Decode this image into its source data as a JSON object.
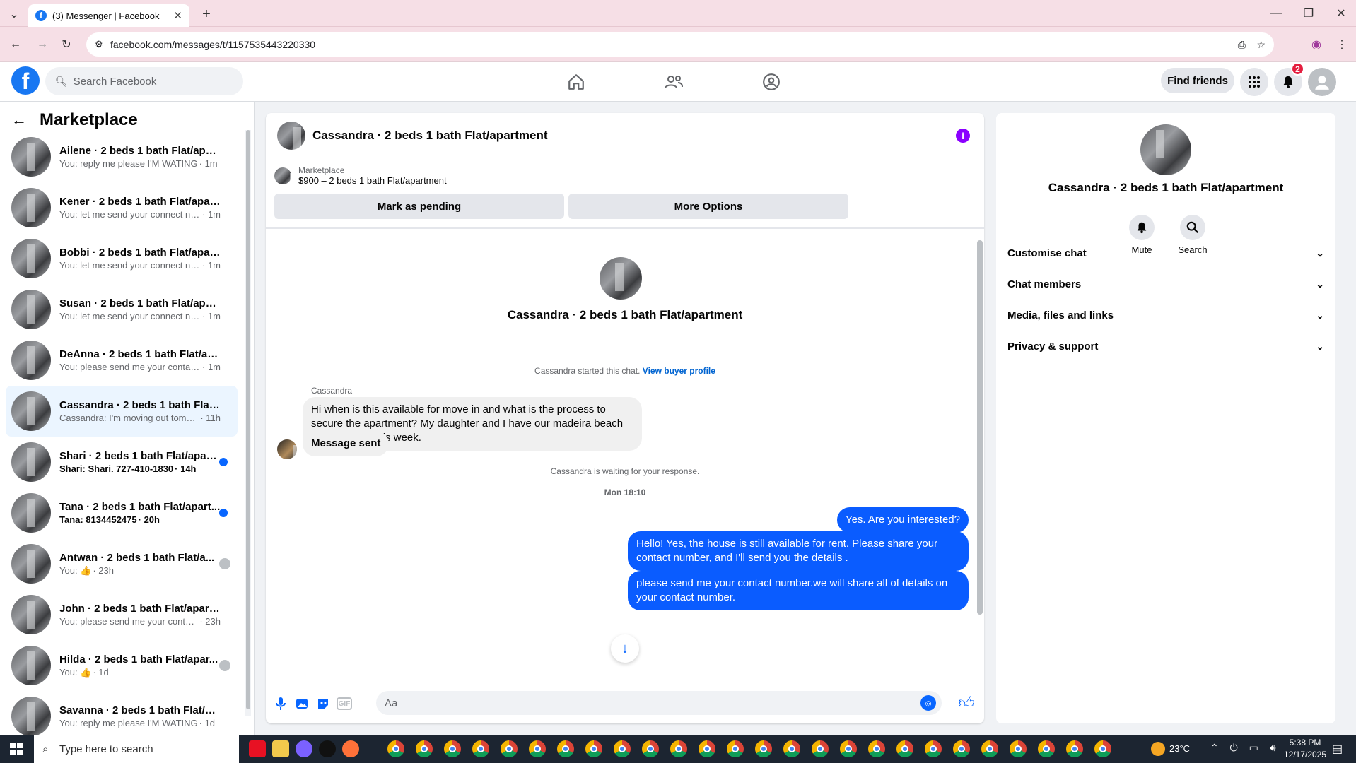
{
  "browser": {
    "tab_title": "(3) Messenger | Facebook",
    "url": "facebook.com/messages/t/1157535443220330"
  },
  "fb": {
    "search_placeholder": "Search Facebook",
    "find_friends": "Find friends",
    "notification_count": "2"
  },
  "left": {
    "title": "Marketplace",
    "conversations": [
      {
        "name": "Ailene · 2 beds 1 bath Flat/apart...",
        "preview": "You: reply me please I'M WATING",
        "time": "· 1m",
        "state": ""
      },
      {
        "name": "Kener · 2 beds 1 bath Flat/apart...",
        "preview": "You: let me send your connect nu...",
        "time": "· 1m",
        "state": ""
      },
      {
        "name": "Bobbi · 2 beds 1 bath Flat/apart...",
        "preview": "You: let me send your connect nu...",
        "time": "· 1m",
        "state": ""
      },
      {
        "name": "Susan · 2 beds 1 bath Flat/apart...",
        "preview": "You: let me send your connect nu...",
        "time": "· 1m",
        "state": ""
      },
      {
        "name": "DeAnna · 2 beds 1 bath Flat/apa...",
        "preview": "You: please send me your contact ...",
        "time": "· 1m",
        "state": ""
      },
      {
        "name": "Cassandra · 2 beds 1 bath Flat/a...",
        "preview": "Cassandra: I'm moving out tomorr...",
        "time": "· 11h",
        "state": "active"
      },
      {
        "name": "Shari · 2 beds 1 bath Flat/apart...",
        "preview": "Shari: Shari. 727-410-1830",
        "time": "· 14h",
        "state": "unread"
      },
      {
        "name": "Tana · 2 beds 1 bath Flat/apart...",
        "preview": "Tana: 8134452475",
        "time": "· 20h",
        "state": "unread"
      },
      {
        "name": "Antwan · 2 beds 1 bath Flat/a...",
        "preview": "You: 👍",
        "time": "· 23h",
        "state": "seen"
      },
      {
        "name": "John · 2 beds 1 bath Flat/apartm...",
        "preview": "You: please send me your contact ...",
        "time": "· 23h",
        "state": ""
      },
      {
        "name": "Hilda · 2 beds 1 bath Flat/apar...",
        "preview": "You: 👍",
        "time": "· 1d",
        "state": "seen"
      },
      {
        "name": "Savanna · 2 beds 1 bath Flat/apa...",
        "preview": "You: reply me please I'M WATING",
        "time": "· 1d",
        "state": ""
      }
    ]
  },
  "chat": {
    "header_title": "Cassandra · 2 beds 1 bath Flat/apartment",
    "marketplace_label": "Marketplace",
    "listing": "$900 – 2 beds 1 bath Flat/apartment",
    "mark_pending": "Mark as pending",
    "more_options": "More Options",
    "center_name": "Cassandra · 2 beds 1 bath Flat/apartment",
    "started_text": "Cassandra started this chat.",
    "view_buyer_profile": "View buyer profile",
    "sender": "Cassandra",
    "msg_in_1": "Hi when is this available for move in and what is the process to secure the apartment? My daughter and I have our madeira beach lease ending this week.",
    "msg_in_2": "Message sent",
    "waiting": "Cassandra is waiting for your response.",
    "timestamp": "Mon 18:10",
    "msg_out_1": "Yes. Are you interested?",
    "msg_out_2": "Hello! Yes, the house is still available for rent. Please share your contact number, and I'll send you the details .",
    "msg_out_3": "please send me your contact number.we will share all of details on your contact number.",
    "input_placeholder": "Aa"
  },
  "right": {
    "name": "Cassandra · 2 beds 1 bath Flat/apartment",
    "mute": "Mute",
    "search": "Search",
    "items": [
      "Customise chat",
      "Chat members",
      "Media, files and links",
      "Privacy & support"
    ]
  },
  "taskbar": {
    "search_placeholder": "Type here to search",
    "temperature": "23°C",
    "time": "5:38 PM",
    "date": "12/17/2025"
  },
  "colors": {
    "brand": "#1877f2",
    "outgoing": "#0a5cff",
    "accent": "#0866ff"
  }
}
